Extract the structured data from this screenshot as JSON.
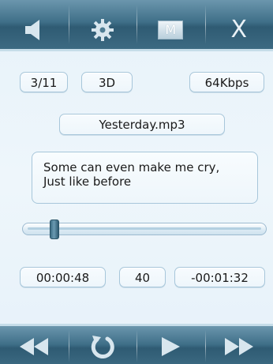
{
  "toolbar": {
    "m_label": "M",
    "close_label": "X"
  },
  "info": {
    "track_position": "3/11",
    "effect": "3D",
    "bitrate": "64Kbps",
    "filename": "Yesterday.mp3"
  },
  "lyrics": {
    "line1": "Some can even make me cry,",
    "line2": "Just like before"
  },
  "progress": {
    "fraction": 0.1
  },
  "status": {
    "elapsed": "00:00:48",
    "volume": "40",
    "remaining": "-00:01:32"
  },
  "colors": {
    "bar": "#3f6f88",
    "panel": "#eef6fb",
    "border": "#a7c6da",
    "icon": "#d8e6ee"
  },
  "icons": {
    "top": [
      "speaker-icon",
      "gear-icon",
      "m-icon",
      "close-icon"
    ],
    "bottom": [
      "rewind-icon",
      "repeat-icon",
      "play-icon",
      "fast-forward-icon"
    ]
  }
}
